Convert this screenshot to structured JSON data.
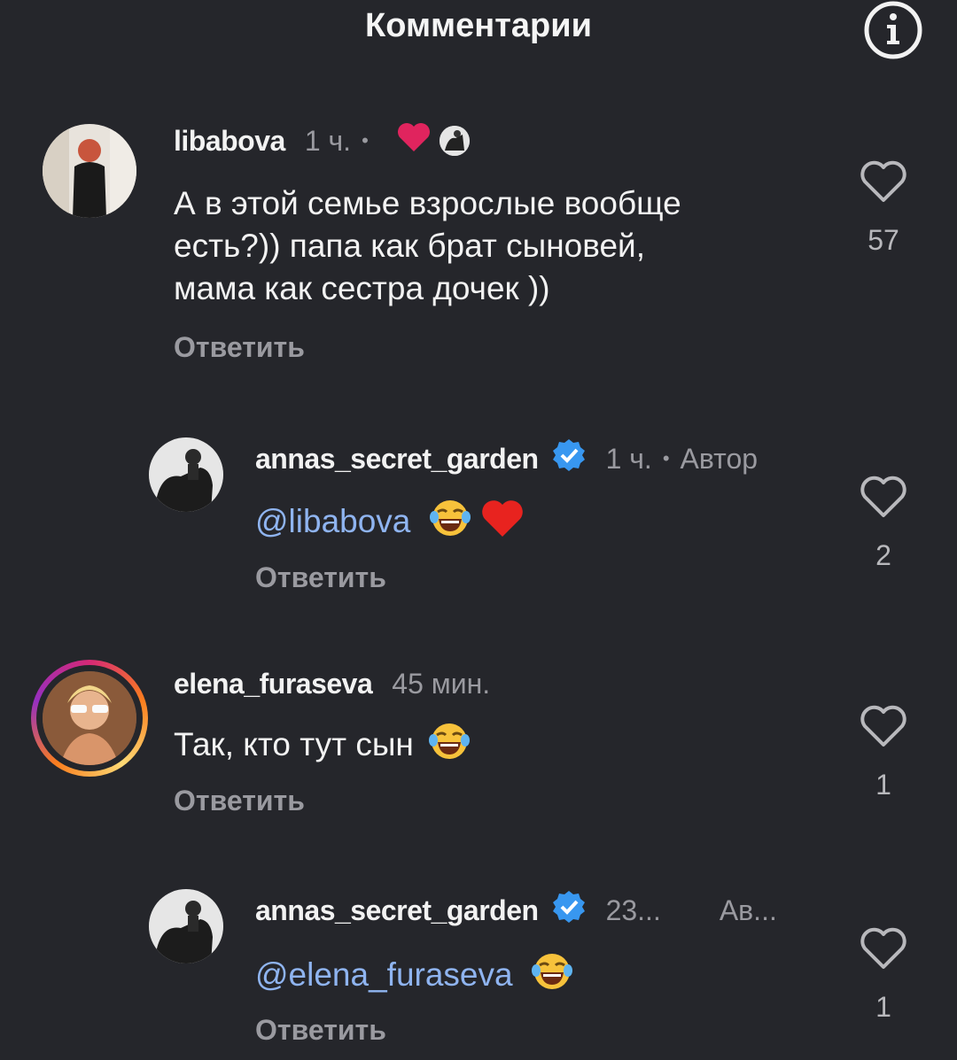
{
  "header": {
    "title": "Комментарии",
    "info_icon": "info-icon"
  },
  "comments": [
    {
      "username": "libabova",
      "time": "1 ч.",
      "text_lines": [
        "А в этой семье взрослые вообще",
        "есть?)) папа как брат сыновей,",
        "мама как сестра дочек ))"
      ],
      "reply_label": "Ответить",
      "likes": "57"
    },
    {
      "username": "annas_secret_garden",
      "time": "1 ч.",
      "author_tag": "Автор",
      "mention": "@libabova",
      "reply_label": "Ответить",
      "likes": "2"
    },
    {
      "username": "elena_furaseva",
      "time": "45 мин.",
      "text": "Так, кто тут сын",
      "reply_label": "Ответить",
      "likes": "1"
    },
    {
      "username": "annas_secret_garden",
      "time": "23...",
      "author_tag": "Ав...",
      "mention": "@elena_furaseva",
      "reply_label": "Ответить",
      "likes": "1"
    }
  ],
  "colors": {
    "background": "#25262b",
    "mention": "#8fb4f0",
    "verified": "#3897f0",
    "heart": "#e0245e"
  }
}
